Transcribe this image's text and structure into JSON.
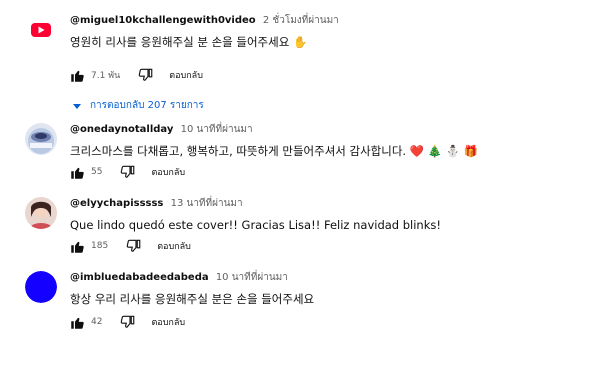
{
  "comments": [
    {
      "author": "@miguel10kchallengewith0video",
      "time": "2 ชั่วโมงที่ผ่านมา",
      "text": "영원히 리사를 응원해주실 분 손을 들어주세요 ✋",
      "likes": "7.1 พัน",
      "reply_label": "ตอบกลับ",
      "replies_label": "การตอบกลับ 207 รายการ",
      "avatar_color": "#ff0033"
    },
    {
      "author": "@onedaynotallday",
      "time": "10 นาทีที่ผ่านมา",
      "text": "크리스마스를 다채롭고, 행복하고, 따뜻하게 만들어주셔서 감사합니다. ❤️ 🎄 ⛄ 🎁",
      "likes": "55",
      "reply_label": "ตอบกลับ"
    },
    {
      "author": "@elyychapisssss",
      "time": "13 นาทีที่ผ่านมา",
      "text": "Que lindo quedó este cover!! Gracias Lisa!! Feliz navidad blinks!",
      "likes": "185",
      "reply_label": "ตอบกลับ"
    },
    {
      "author": "@imbluedabadeedabeda",
      "time": "10 นาทีที่ผ่านมา",
      "text": "항상 우리 리사를 응원해주실 분은 손을 들어주세요",
      "likes": "42",
      "reply_label": "ตอบกลับ",
      "avatar_color": "#1400ff"
    }
  ],
  "icons": {
    "like": "thumbs-up-icon",
    "dislike": "thumbs-down-icon",
    "expand": "chevron-down-icon"
  }
}
